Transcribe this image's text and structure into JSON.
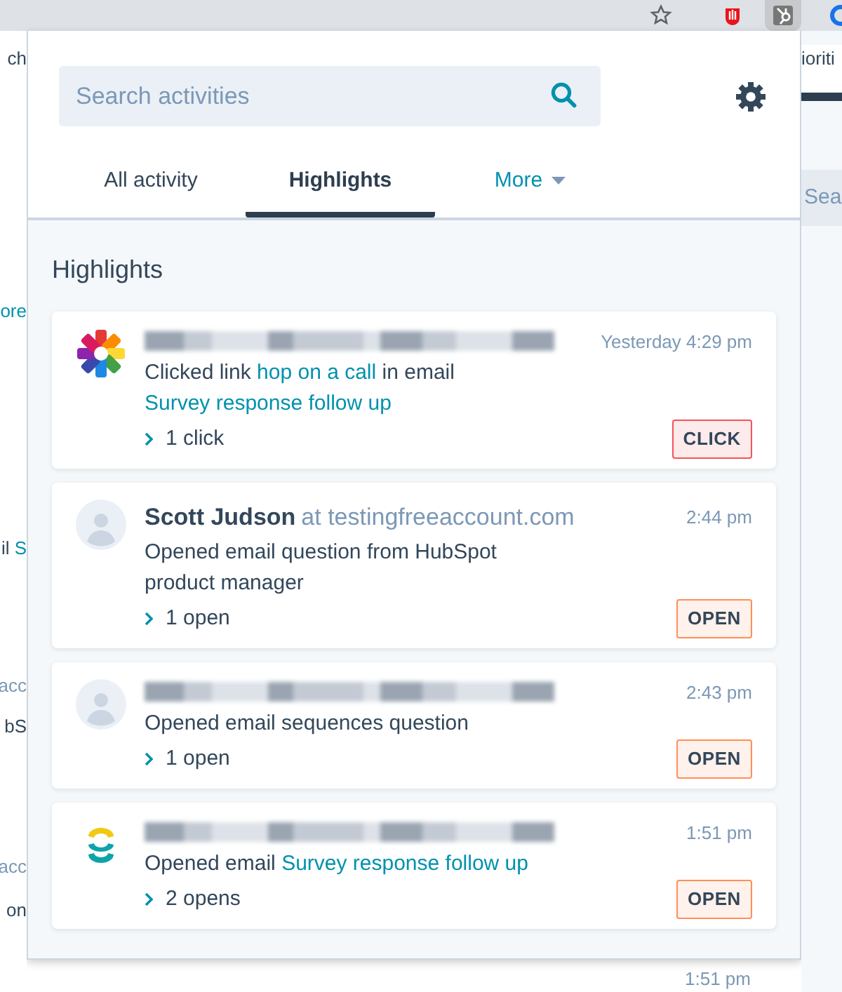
{
  "background_page": {
    "left_fragments": [
      {
        "kind": "text",
        "text": "ch"
      },
      {
        "kind": "link",
        "text": "ore"
      },
      {
        "kind": "mixed",
        "text": "il ",
        "link": "S"
      },
      {
        "kind": "muted",
        "text": "acc"
      },
      {
        "kind": "text",
        "text": "bS"
      },
      {
        "kind": "muted",
        "text": "acc"
      },
      {
        "kind": "text",
        "text": "on"
      }
    ],
    "right_fragments": [
      {
        "kind": "text",
        "text": "ioriti"
      },
      {
        "kind": "field",
        "text": "Sea"
      }
    ],
    "below_popup_time": "1:51 pm"
  },
  "popup": {
    "search": {
      "placeholder": "Search activities"
    },
    "tabs": [
      {
        "label": "All activity",
        "selected": false,
        "dropdown": false
      },
      {
        "label": "Highlights",
        "selected": true,
        "dropdown": false
      },
      {
        "label": "More",
        "selected": false,
        "dropdown": true
      }
    ],
    "section_title": "Highlights",
    "activities": [
      {
        "avatar": {
          "kind": "star-logo"
        },
        "redacted_name": true,
        "time": "Yesterday 4:29 pm",
        "description": [
          {
            "text": "Clicked link "
          },
          {
            "text": "hop on a call",
            "link": true
          },
          {
            "text": " in email "
          },
          {
            "text": "Survey response follow up",
            "link": true
          }
        ],
        "count": "1 click",
        "badge": {
          "color": "#f2545b",
          "label": "CLICK"
        }
      },
      {
        "avatar": {
          "kind": "person"
        },
        "redacted_name": false,
        "name": "Scott Judson",
        "company": "at testingfreeaccount.com",
        "time": "2:44 pm",
        "description": [
          {
            "text": "Opened email question from HubSpot product manager"
          }
        ],
        "count": "1 open",
        "badge": {
          "color": "#ff8f59",
          "label": "OPEN"
        }
      },
      {
        "avatar": {
          "kind": "person"
        },
        "redacted_name": true,
        "time": "2:43 pm",
        "description": [
          {
            "text": "Opened email sequences question"
          }
        ],
        "count": "1 open",
        "badge": {
          "color": "#ff8f59",
          "label": "OPEN"
        }
      },
      {
        "avatar": {
          "kind": "ring-logo"
        },
        "redacted_name": true,
        "time": "1:51 pm",
        "description": [
          {
            "text": "Opened email "
          },
          {
            "text": "Survey response follow up",
            "link": true
          }
        ],
        "count": "2 opens",
        "badge": {
          "color": "#ff8f59",
          "label": "OPEN"
        }
      }
    ]
  }
}
